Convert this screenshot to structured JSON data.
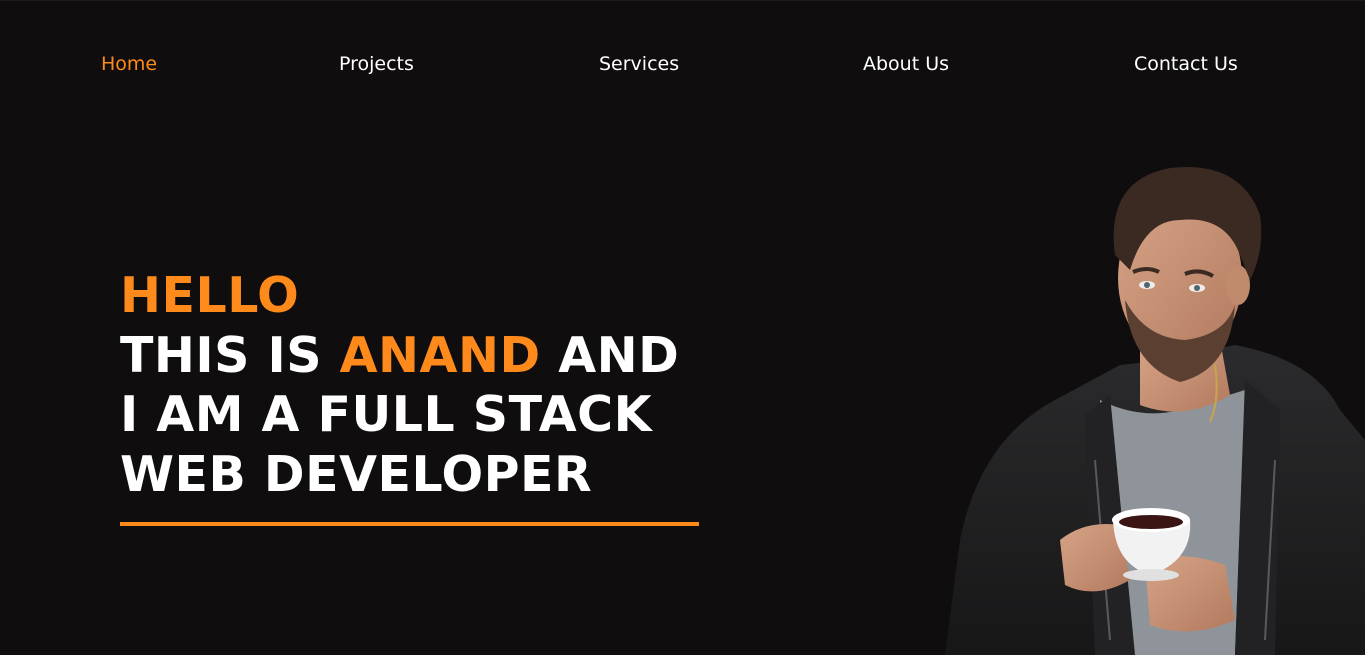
{
  "nav": {
    "items": [
      {
        "label": "Home",
        "active": true
      },
      {
        "label": "Projects",
        "active": false
      },
      {
        "label": "Services",
        "active": false
      },
      {
        "label": "About Us",
        "active": false
      },
      {
        "label": "Contact Us",
        "active": false
      }
    ]
  },
  "hero": {
    "greeting": "HELLO",
    "line1_prefix": "THIS IS ",
    "name": "ANAND",
    "line1_suffix": " AND",
    "line2": "I AM A FULL STACK",
    "line3": "WEB DEVELOPER"
  },
  "colors": {
    "background": "#0f0d0e",
    "accent": "#ff8a1c",
    "text": "#ffffff"
  },
  "portrait": {
    "icon": "person-with-coffee-photo"
  }
}
